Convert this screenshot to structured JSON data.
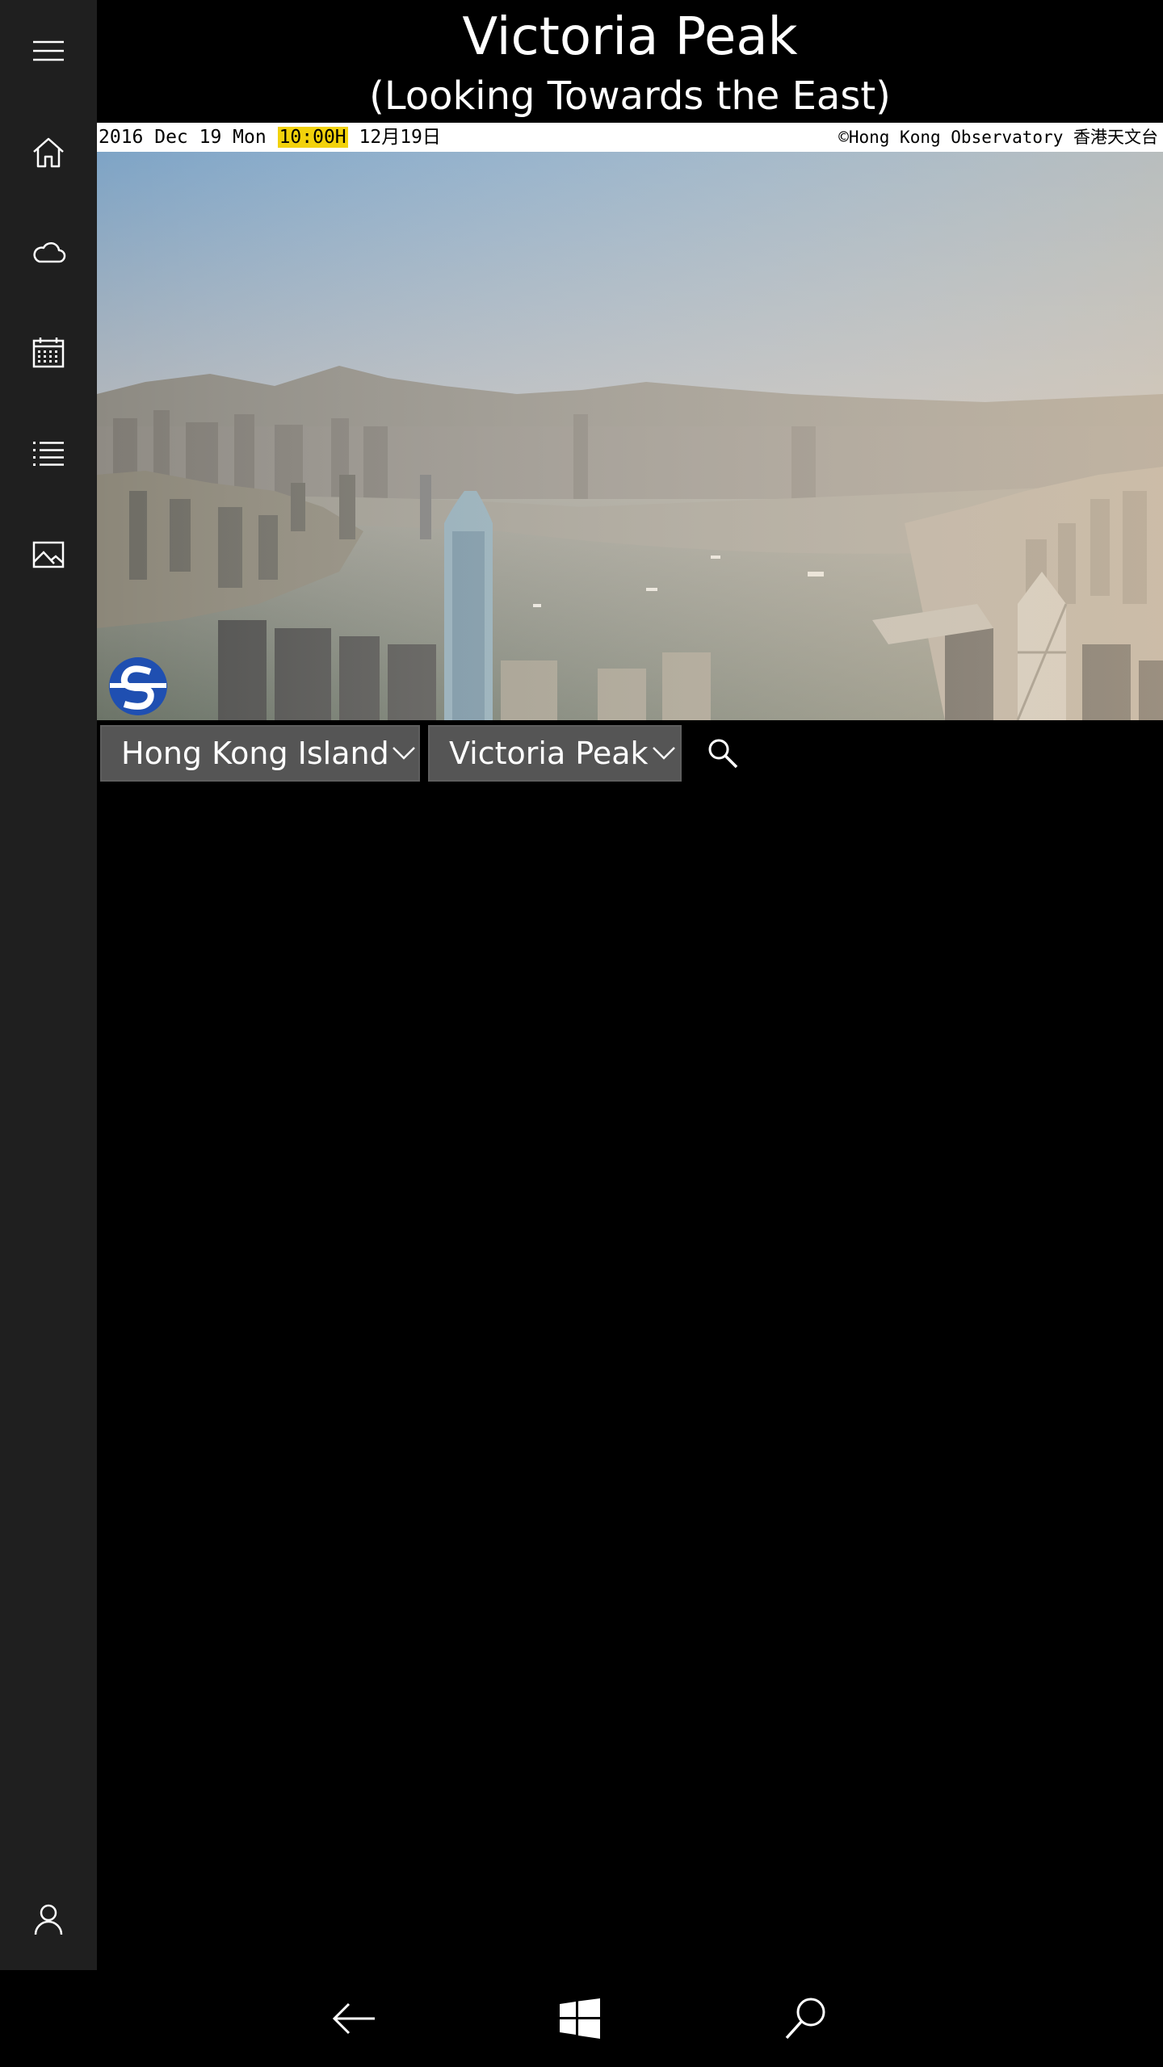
{
  "header": {
    "title": "Victoria Peak",
    "subtitle": "(Looking Towards the East)"
  },
  "camera": {
    "stamp_date": "2016 Dec 19 Mon ",
    "stamp_time": "10:00H",
    "stamp_local_date": " 12月19日",
    "copyright": "©Hong Kong Observatory 香港天文台",
    "logo": "hong-kong-observatory-logo"
  },
  "sidebar": {
    "items": [
      {
        "icon": "hamburger-menu-icon"
      },
      {
        "icon": "home-icon"
      },
      {
        "icon": "cloud-icon"
      },
      {
        "icon": "calendar-icon"
      },
      {
        "icon": "list-icon"
      },
      {
        "icon": "image-icon"
      },
      {
        "icon": "user-icon"
      }
    ]
  },
  "selectors": {
    "region": "Hong Kong Island",
    "station": "Victoria Peak"
  },
  "system_bar": {
    "back": "back-arrow-icon",
    "start": "windows-logo-icon",
    "search": "search-icon"
  },
  "colors": {
    "sidebar_bg": "#1f1f1f",
    "background": "#000000",
    "dropdown_bg": "#555555",
    "time_highlight": "#f2d20b"
  }
}
